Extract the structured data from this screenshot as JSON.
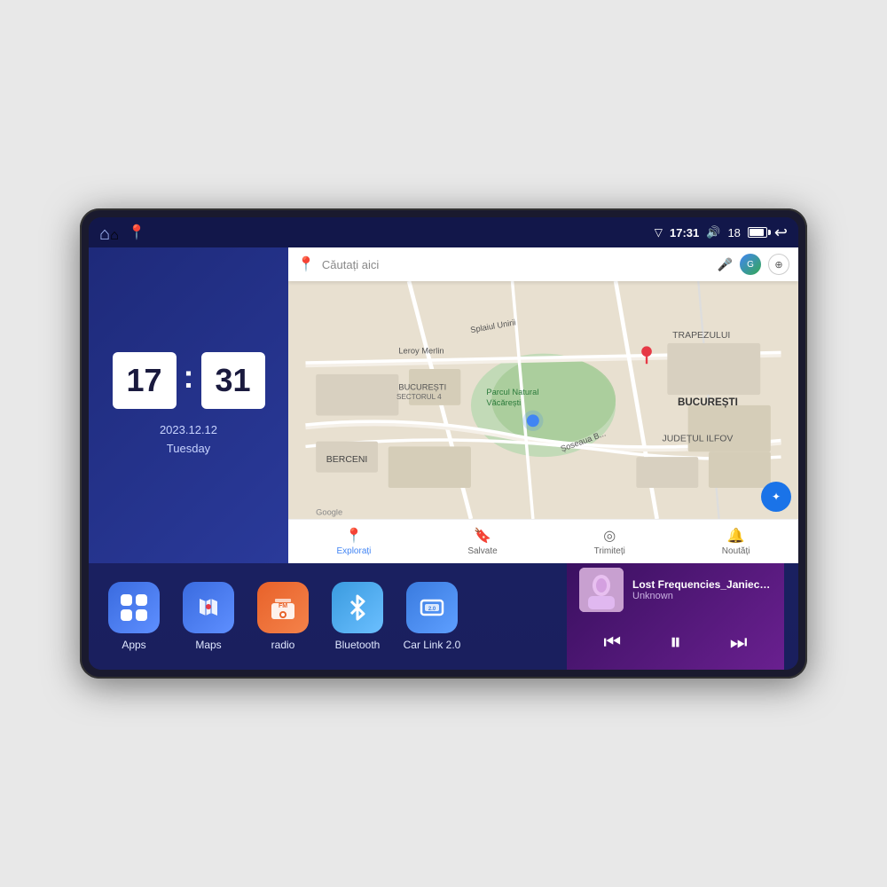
{
  "device": {
    "status_bar": {
      "signal_icon": "▽",
      "time": "17:31",
      "volume_icon": "🔊",
      "volume_level": "18",
      "battery_icon": "battery",
      "back_icon": "↩"
    },
    "clock": {
      "hour": "17",
      "minute": "31",
      "date": "2023.12.12",
      "day": "Tuesday"
    },
    "map": {
      "search_placeholder": "Căutați aici",
      "bottom_nav": [
        {
          "label": "Explorați",
          "icon": "📍",
          "active": true
        },
        {
          "label": "Salvate",
          "icon": "🔖",
          "active": false
        },
        {
          "label": "Trimiteți",
          "icon": "◎",
          "active": false
        },
        {
          "label": "Noutăți",
          "icon": "🔔",
          "active": false
        }
      ],
      "locations": [
        "TRAPEZULUI",
        "BUCUREȘTI",
        "JUDEȚUL ILFOV",
        "Parcul Natural Văcărești",
        "Leroy Merlin",
        "BERCENI",
        "BUCUREȘTI SECTORUL 4"
      ]
    },
    "apps": [
      {
        "id": "apps",
        "label": "Apps",
        "icon_type": "apps",
        "bg_class": "icon-apps"
      },
      {
        "id": "maps",
        "label": "Maps",
        "icon_type": "maps",
        "bg_class": "icon-maps"
      },
      {
        "id": "radio",
        "label": "radio",
        "icon_type": "radio",
        "bg_class": "icon-radio"
      },
      {
        "id": "bluetooth",
        "label": "Bluetooth",
        "icon_type": "bluetooth",
        "bg_class": "icon-bluetooth"
      },
      {
        "id": "carlink",
        "label": "Car Link 2.0",
        "icon_type": "carlink",
        "bg_class": "icon-carlink"
      }
    ],
    "music": {
      "title": "Lost Frequencies_Janieck Devy-...",
      "artist": "Unknown",
      "prev_icon": "⏮",
      "play_icon": "⏸",
      "next_icon": "⏭"
    }
  }
}
